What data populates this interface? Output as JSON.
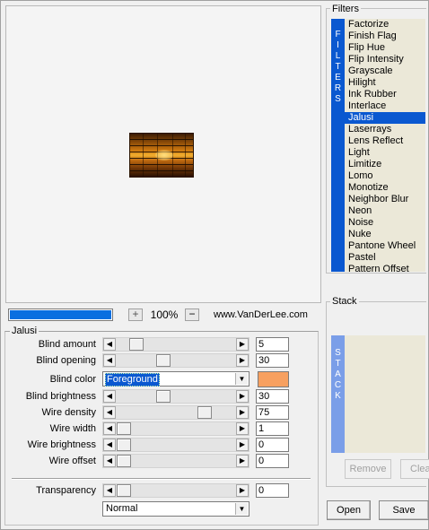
{
  "zoom": {
    "plus": "+",
    "value": "100%",
    "minus": "−",
    "progress": 1.0
  },
  "site": "www.VanDerLee.com",
  "group_title": "Jalusi",
  "sliders": [
    {
      "label": "Blind amount",
      "value": "5",
      "position": 0.12
    },
    {
      "label": "Blind opening",
      "value": "30",
      "position": 0.37
    },
    {
      "label": "Blind brightness",
      "value": "30",
      "position": 0.37
    },
    {
      "label": "Wire density",
      "value": "75",
      "position": 0.76
    },
    {
      "label": "Wire width",
      "value": "1",
      "position": 0.0
    },
    {
      "label": "Wire brightness",
      "value": "0",
      "position": 0.0
    },
    {
      "label": "Wire offset",
      "value": "0",
      "position": 0.0
    }
  ],
  "blind_color": {
    "label": "Blind color",
    "value": "Foreground",
    "swatch": "#f7a060"
  },
  "transparency": {
    "label": "Transparency",
    "value": "0",
    "position": 0.0
  },
  "blend_mode": "Normal",
  "filters": {
    "title": "Filters",
    "band": [
      "F",
      "I",
      "L",
      "T",
      "E",
      "R",
      "S"
    ],
    "items": [
      "Factorize",
      "Finish Flag",
      "Flip Hue",
      "Flip Intensity",
      "Grayscale",
      "Hilight",
      "Ink Rubber",
      "Interlace",
      "Jalusi",
      "Laserrays",
      "Lens Reflect",
      "Light",
      "Limitize",
      "Lomo",
      "Monotize",
      "Neighbor Blur",
      "Neon",
      "Noise",
      "Nuke",
      "Pantone Wheel",
      "Pastel",
      "Pattern Offset"
    ],
    "selected": "Jalusi"
  },
  "stack": {
    "title": "Stack",
    "band": [
      "S",
      "T",
      "A",
      "C",
      "K"
    ],
    "remove": "Remove",
    "clear": "Clear"
  },
  "buttons": {
    "open": "Open",
    "save": "Save"
  },
  "colors": {
    "accent": "#0a58d0",
    "progress": "#0a6fe0",
    "stack_band": "#7a9ee8",
    "list_bg": "#ebe8d8"
  }
}
